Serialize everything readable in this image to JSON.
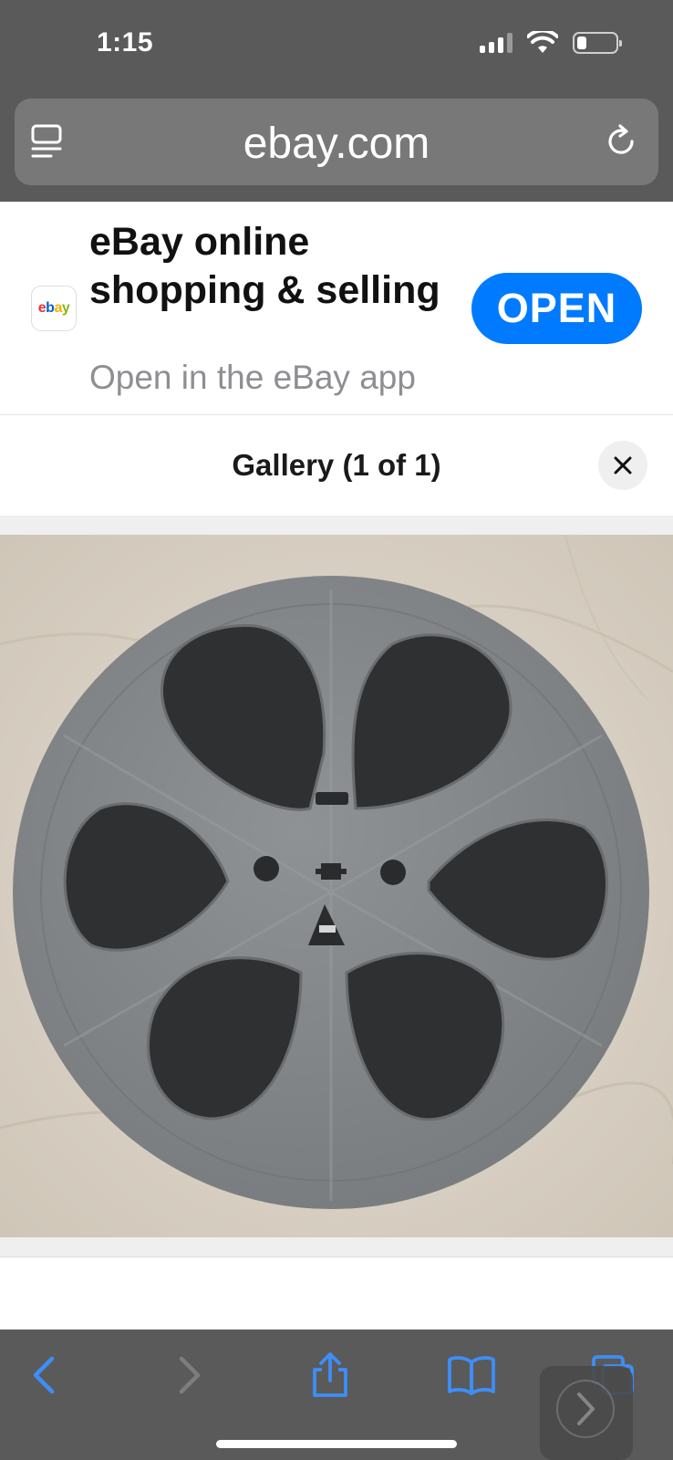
{
  "status_bar": {
    "time": "1:15"
  },
  "url_bar": {
    "domain": "ebay.com"
  },
  "app_banner": {
    "icon_text": "ebay",
    "title": "eBay online shopping & selling",
    "subtitle": "Open in the eBay app",
    "open_label": "OPEN"
  },
  "gallery": {
    "title": "Gallery (1 of 1)"
  },
  "colors": {
    "accent": "#007aff",
    "chrome": "#5a5a5a"
  },
  "icons": {
    "reader": "reader-mode-icon",
    "reload": "reload-icon",
    "close": "close-icon",
    "back": "back-arrow-icon",
    "forward": "forward-arrow-icon",
    "share": "share-icon",
    "bookmarks": "bookmarks-icon",
    "tabs": "tabs-icon"
  }
}
